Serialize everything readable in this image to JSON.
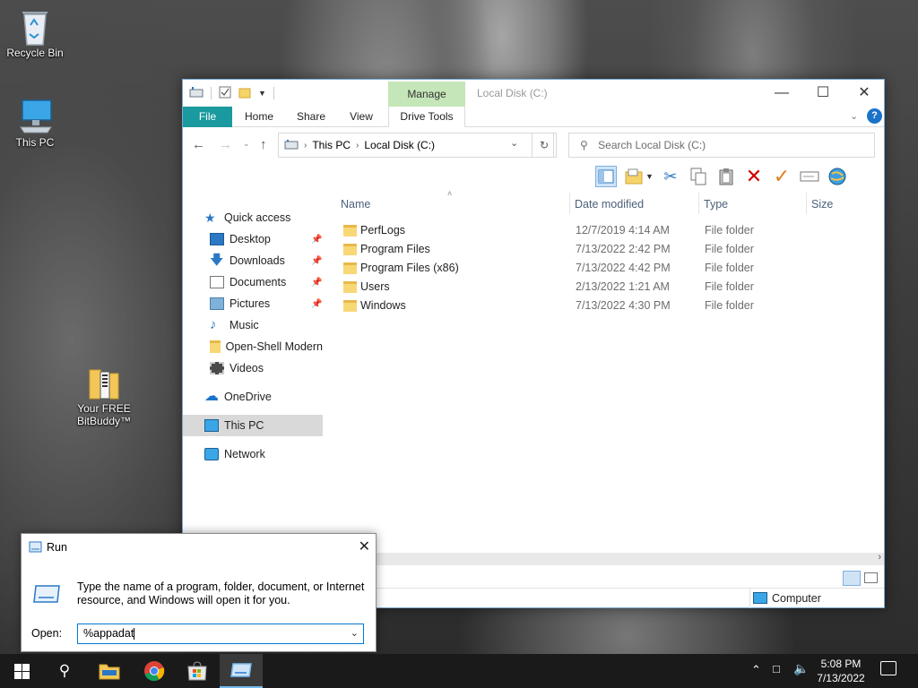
{
  "desktop": {
    "icons": [
      {
        "label": "Recycle Bin",
        "icon": "recycle-bin-icon"
      },
      {
        "label": "This PC",
        "icon": "computer-icon"
      },
      {
        "label": "Your FREE BitBuddy™",
        "icon": "archive-icon"
      }
    ]
  },
  "explorer": {
    "title": "Local Disk (C:)",
    "manage_tab": "Manage",
    "tabs": [
      "File",
      "Home",
      "Share",
      "View",
      "Drive Tools"
    ],
    "breadcrumb": [
      "This PC",
      "Local Disk (C:)"
    ],
    "search_placeholder": "Search Local Disk (C:)",
    "columns": [
      "Name",
      "Date modified",
      "Type",
      "Size"
    ],
    "nav": [
      {
        "label": "Quick access",
        "icon": "star-icon",
        "pinned": false
      },
      {
        "label": "Desktop",
        "icon": "desktop-icon",
        "pinned": true
      },
      {
        "label": "Downloads",
        "icon": "download-icon",
        "pinned": true
      },
      {
        "label": "Documents",
        "icon": "documents-icon",
        "pinned": true
      },
      {
        "label": "Pictures",
        "icon": "pictures-icon",
        "pinned": true
      },
      {
        "label": "Music",
        "icon": "music-icon",
        "pinned": false
      },
      {
        "label": "Open-Shell Modern",
        "icon": "folder-icon",
        "pinned": false
      },
      {
        "label": "Videos",
        "icon": "videos-icon",
        "pinned": false
      },
      {
        "label": "OneDrive",
        "icon": "cloud-icon",
        "pinned": false
      },
      {
        "label": "This PC",
        "icon": "computer-icon",
        "pinned": false,
        "selected": true
      },
      {
        "label": "Network",
        "icon": "network-icon",
        "pinned": false
      }
    ],
    "files": [
      {
        "name": "PerfLogs",
        "date": "12/7/2019 4:14 AM",
        "type": "File folder"
      },
      {
        "name": "Program Files",
        "date": "7/13/2022 2:42 PM",
        "type": "File folder"
      },
      {
        "name": "Program Files (x86)",
        "date": "7/13/2022 4:42 PM",
        "type": "File folder"
      },
      {
        "name": "Users",
        "date": "2/13/2022 1:21 AM",
        "type": "File folder"
      },
      {
        "name": "Windows",
        "date": "7/13/2022 4:30 PM",
        "type": "File folder"
      }
    ],
    "status_location": "Computer"
  },
  "run_dialog": {
    "title": "Run",
    "description": "Type the name of a program, folder, document, or Internet resource, and Windows will open it for you.",
    "open_label": "Open:",
    "open_value": "%appadat"
  },
  "taskbar": {
    "time": "5:08 PM",
    "date": "7/13/2022",
    "pinned": [
      "file-explorer-icon",
      "chrome-icon",
      "store-icon",
      "run-icon"
    ]
  },
  "colors": {
    "accent": "#1a9a9e",
    "manage_tab": "#c5e6b8",
    "taskbar": "#1a1a1a",
    "delete_red": "#d00000",
    "check_orange": "#e27d1c"
  }
}
